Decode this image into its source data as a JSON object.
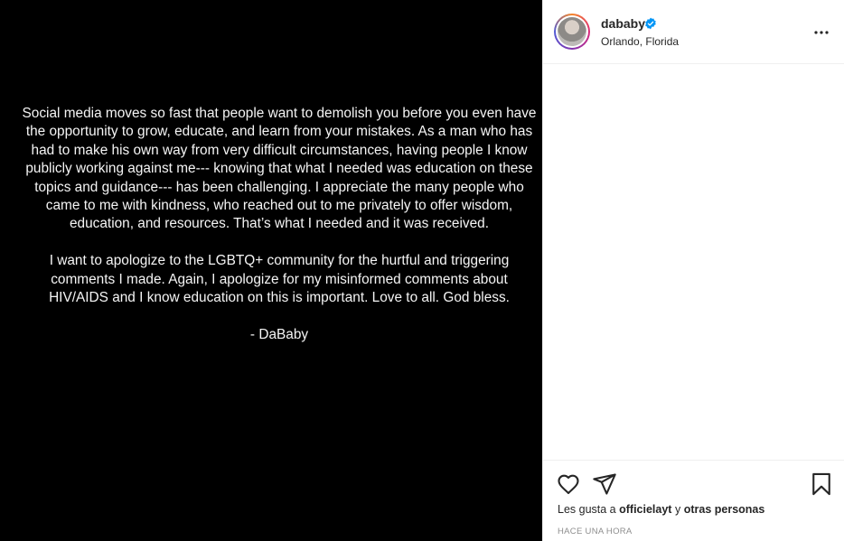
{
  "post": {
    "paragraphs": [
      "Social media moves so fast that people want to demolish you before you even have the opportunity to grow, educate, and learn from your mistakes. As a man who has had to make his own way from very difficult circumstances, having people I know publicly working against me--- knowing that what I needed was education on these topics and guidance--- has been challenging. I appreciate the many people who came to me with kindness, who reached out to me privately to offer wisdom, education, and resources. That’s what I needed and it was received.",
      "I want to apologize to the LGBTQ+ community for the hurtful and triggering comments I made. Again, I apologize for my misinformed comments about HIV/AIDS and I know education on this is important. Love to all. God bless.",
      "- DaBaby"
    ]
  },
  "header": {
    "username": "dababy",
    "location": "Orlando, Florida",
    "verified_color": "#0095f6",
    "more_icon": "more-options-icon"
  },
  "actions": {
    "like_icon": "heart-icon",
    "share_icon": "paper-plane-icon",
    "save_icon": "bookmark-icon"
  },
  "likes": {
    "prefix": "Les gusta a",
    "user": "officielayt",
    "connector": "y",
    "suffix": "otras personas"
  },
  "timestamp": "HACE UNA HORA"
}
